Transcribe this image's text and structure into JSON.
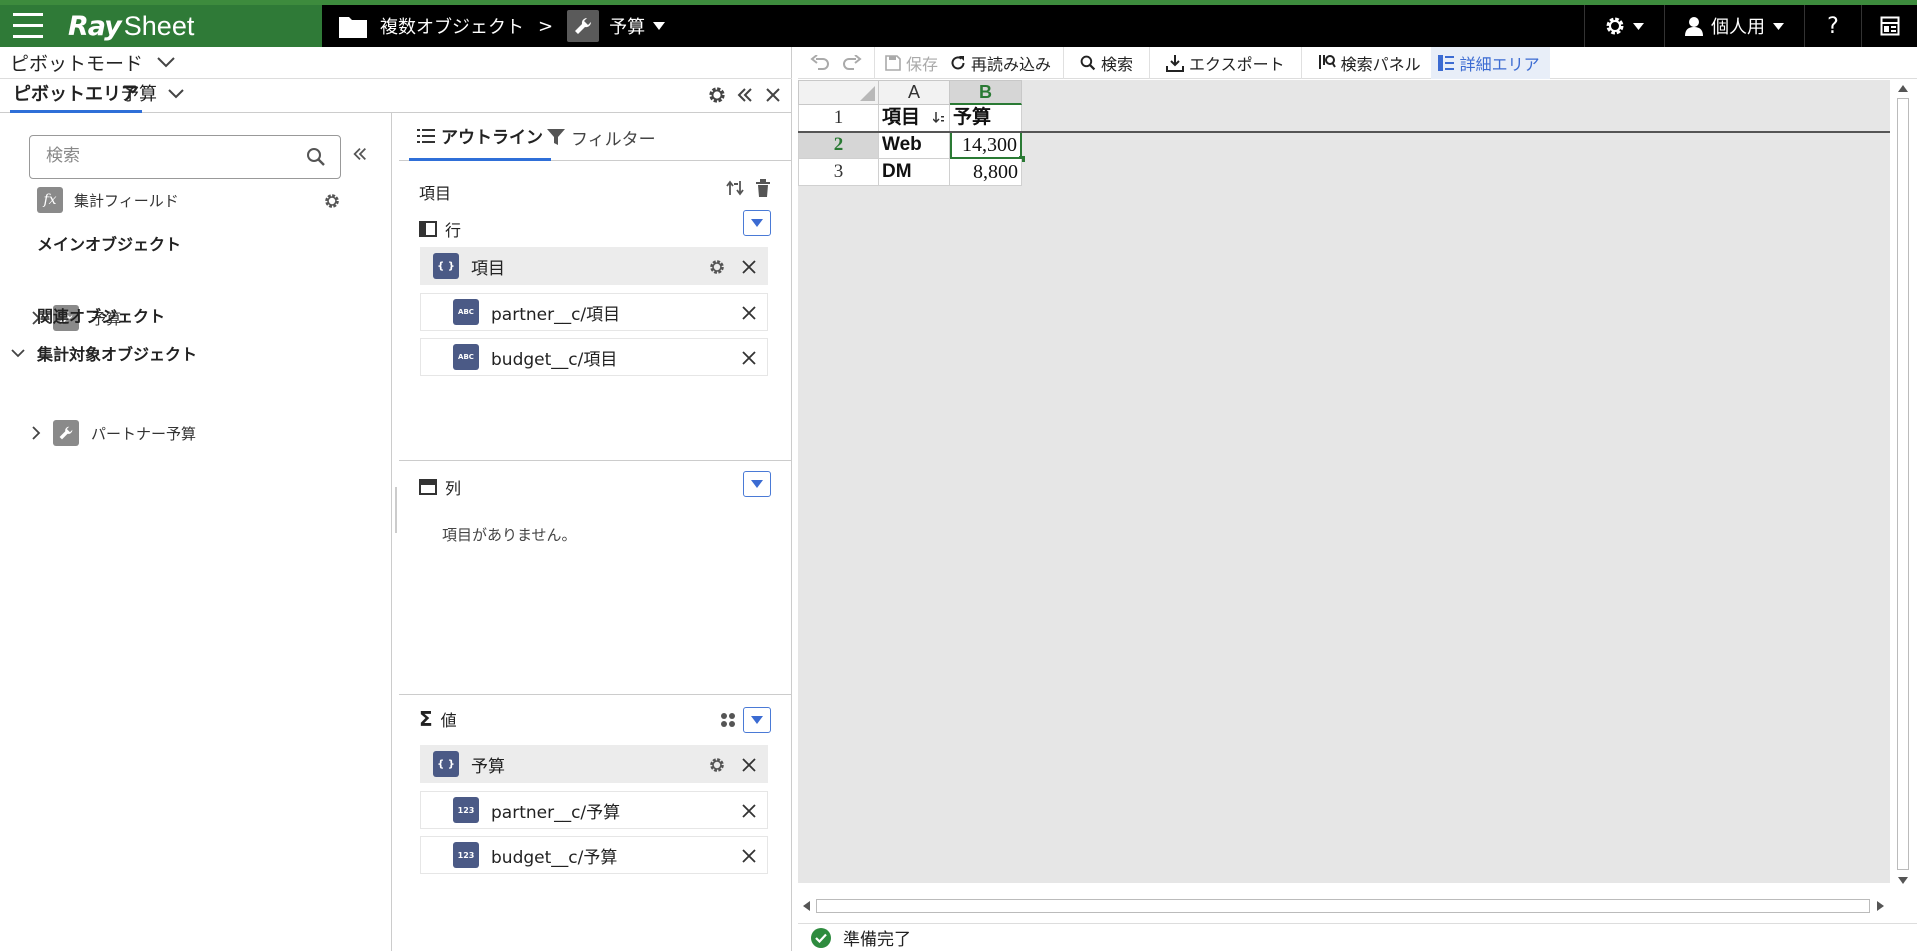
{
  "app": {
    "logo_ray": "Ray",
    "logo_sheet": "Sheet",
    "brand_color": "#2f7a37",
    "accent_color": "#2f6fd8"
  },
  "header": {
    "breadcrumb_folder": "複数オブジェクト",
    "breadcrumb_separator": ">",
    "breadcrumb_current": "予算",
    "user_label": "個人用",
    "help_label": "?"
  },
  "left": {
    "mode_label": "ピボットモード",
    "area_tab_label": "ピボットエリア",
    "area_name": "予算",
    "search": {
      "placeholder": "検索",
      "value": ""
    },
    "calc_field_label": "集計フィールド",
    "main_object_header": "メインオブジェクト",
    "main_object_item": "予算",
    "related_object_header": "関連オブジェクト",
    "aggregate_object_header": "集計対象オブジェクト",
    "aggregate_object_item": "パートナー予算"
  },
  "outline": {
    "tabs": [
      {
        "label": "アウトライン",
        "active": true
      },
      {
        "label": "フィルター",
        "active": false
      }
    ],
    "items_header": "項目",
    "rows_zone": {
      "title": "行",
      "parent": {
        "badge": "{ }",
        "label": "項目"
      },
      "children": [
        {
          "badge": "ABC",
          "label": "partner__c/項目"
        },
        {
          "badge": "ABC",
          "label": "budget__c/項目"
        }
      ]
    },
    "columns_zone": {
      "title": "列",
      "empty_text": "項目がありません。"
    },
    "values_zone": {
      "title": "値",
      "sigma": "Σ",
      "parent": {
        "badge": "{ }",
        "label": "予算"
      },
      "children": [
        {
          "badge": "123",
          "label": "partner__c/予算"
        },
        {
          "badge": "123",
          "label": "budget__c/予算"
        }
      ]
    }
  },
  "toolbar": {
    "save_label": "保存",
    "reload_label": "再読み込み",
    "search_label": "検索",
    "export_label": "エクスポート",
    "search_panel_label": "検索パネル",
    "detail_area_label": "詳細エリア"
  },
  "sheet": {
    "col_headers": [
      "A",
      "B"
    ],
    "row_headers": [
      "1",
      "2",
      "3"
    ],
    "rows": [
      [
        "項目",
        "予算"
      ],
      [
        "Web",
        "14,300"
      ],
      [
        "DM",
        "8,800"
      ]
    ],
    "selected_cell": "B2",
    "selection_color": "#2a7a34"
  },
  "status": {
    "text": "準備完了",
    "ok_color": "#2e8b3e"
  }
}
